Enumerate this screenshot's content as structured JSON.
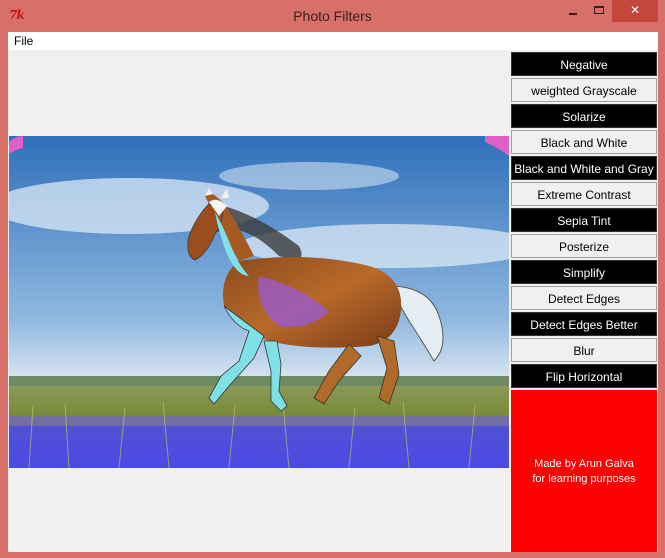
{
  "window": {
    "title": "Photo Filters",
    "app_icon_text": "7k",
    "controls": {
      "minimize": "",
      "maximize": "",
      "close": "✕"
    }
  },
  "menu": {
    "file_label": "File"
  },
  "filters": [
    {
      "label": "Negative",
      "style": "dark"
    },
    {
      "label": "weighted Grayscale",
      "style": "light"
    },
    {
      "label": "Solarize",
      "style": "dark"
    },
    {
      "label": "Black and White",
      "style": "light"
    },
    {
      "label": "Black and White and Gray",
      "style": "dark"
    },
    {
      "label": "Extreme Contrast",
      "style": "light"
    },
    {
      "label": "Sepia Tint",
      "style": "dark"
    },
    {
      "label": "Posterize",
      "style": "light"
    },
    {
      "label": "Simplify",
      "style": "dark"
    },
    {
      "label": "Detect Edges",
      "style": "light"
    },
    {
      "label": "Detect Edges Better",
      "style": "dark"
    },
    {
      "label": "Blur",
      "style": "light"
    },
    {
      "label": "Flip Horizontal",
      "style": "dark"
    }
  ],
  "credits": {
    "line1": "Made by Arun Galva",
    "line2": "for learning purposes",
    "background": "#ff0000"
  },
  "image": {
    "subject": "horse-photo"
  }
}
